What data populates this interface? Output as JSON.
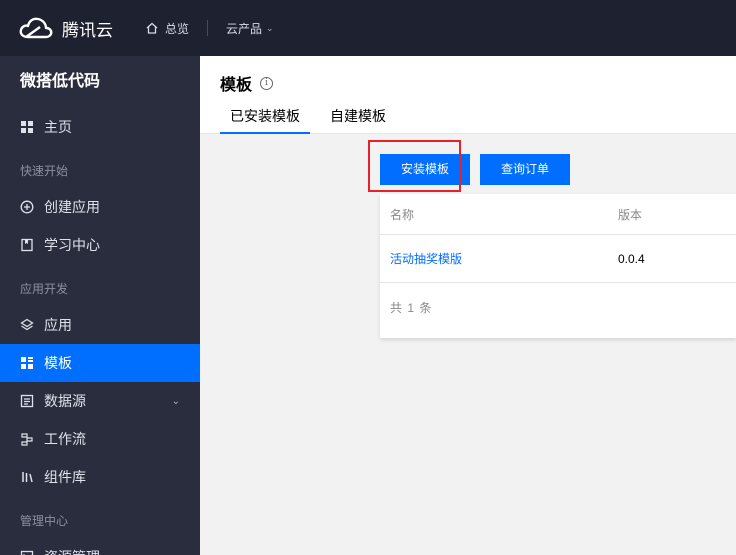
{
  "topbar": {
    "brand": "腾讯云",
    "overview": "总览",
    "products": "云产品"
  },
  "sidebar": {
    "title": "微搭低代码",
    "home": "主页",
    "group_quickstart": "快速开始",
    "create_app": "创建应用",
    "learning": "学习中心",
    "group_dev": "应用开发",
    "apps": "应用",
    "templates": "模板",
    "datasource": "数据源",
    "workflow": "工作流",
    "components": "组件库",
    "group_manage": "管理中心",
    "resources": "资源管理"
  },
  "main": {
    "title": "模板",
    "tabs": [
      "已安装模板",
      "自建模板"
    ],
    "buttons": {
      "install": "安装模板",
      "orders": "查询订单"
    },
    "table": {
      "columns": [
        "名称",
        "版本"
      ],
      "rows": [
        {
          "name": "活动抽奖模版",
          "version": "0.0.4"
        }
      ],
      "footer": "共 1 条"
    }
  },
  "colors": {
    "accent": "#006eff",
    "topbar": "#1d2130",
    "sidebar": "#292d3e",
    "highlight": "#e8202a"
  }
}
